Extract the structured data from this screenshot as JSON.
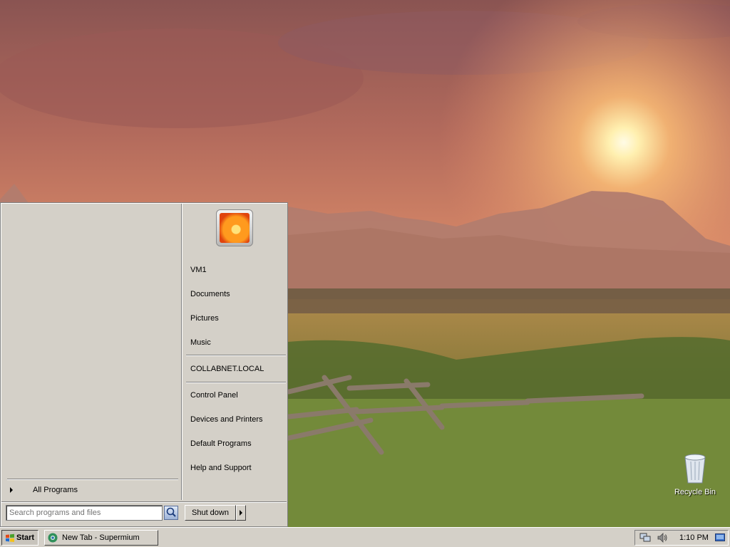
{
  "desktop": {
    "icons": [
      {
        "label": "Recycle Bin",
        "icon": "recycle-bin-icon"
      }
    ]
  },
  "start_menu": {
    "all_programs_label": "All Programs",
    "right_items": [
      {
        "label": "VM1"
      },
      {
        "label": "Documents"
      },
      {
        "label": "Pictures"
      },
      {
        "label": "Music"
      },
      {
        "label": "COLLABNET.LOCAL"
      },
      {
        "label": "Control Panel"
      },
      {
        "label": "Devices and Printers"
      },
      {
        "label": "Default Programs"
      },
      {
        "label": "Help and Support"
      }
    ],
    "search_placeholder": "Search programs and files",
    "shutdown_label": "Shut down"
  },
  "taskbar": {
    "start_label": "Start",
    "tasks": [
      {
        "label": "New Tab - Supermium",
        "icon": "supermium-icon"
      }
    ],
    "clock": "1:10 PM"
  }
}
